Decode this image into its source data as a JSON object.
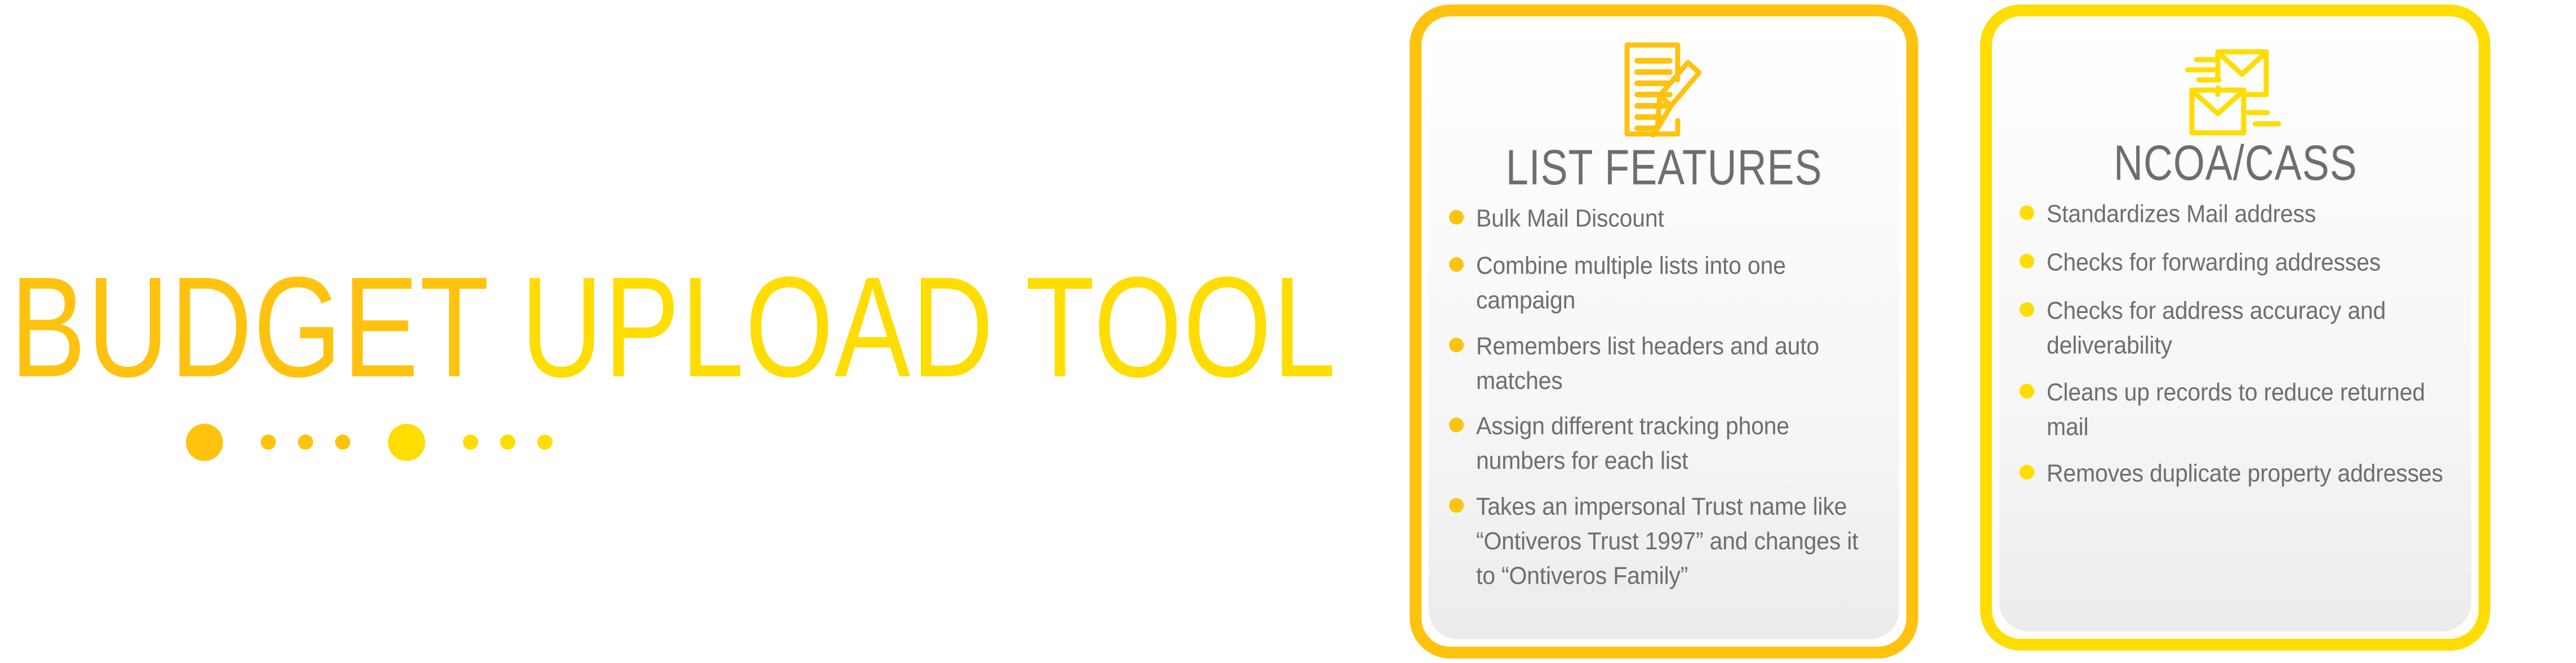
{
  "hero": {
    "title_part1": "BUDGET ",
    "title_part2": "UPLOAD TOOL",
    "accent_amber": "#FFC20E",
    "accent_yellow": "#FFDD00",
    "dots": [
      {
        "size": "big",
        "color": "#FFC20E"
      },
      {
        "size": "small",
        "color": "#FFC20E"
      },
      {
        "size": "small",
        "color": "#FFC20E"
      },
      {
        "size": "small",
        "color": "#FFC20E"
      },
      {
        "size": "big",
        "color": "#FFDD00"
      },
      {
        "size": "small",
        "color": "#FFDD00"
      },
      {
        "size": "small",
        "color": "#FFDD00"
      },
      {
        "size": "small",
        "color": "#FFDD00"
      }
    ]
  },
  "cards": [
    {
      "id": "list-features",
      "icon": "document-pen-icon",
      "title": "LIST FEATURES",
      "border_color": "#FFC20E",
      "bullets": [
        "Bulk Mail Discount",
        "Combine multiple lists into one campaign",
        "Remembers list headers and auto matches",
        "Assign different tracking phone numbers for each list",
        "Takes an impersonal Trust name like “Ontiveros Trust 1997” and changes it to “Ontiveros Family”"
      ]
    },
    {
      "id": "ncoa-cass",
      "icon": "envelopes-forwarding-icon",
      "title": "NCOA/CASS",
      "border_color": "#FFDD00",
      "bullets": [
        "Standardizes Mail address",
        "Checks for forwarding addresses",
        "Checks for address accuracy and deliverability",
        "Cleans up records to reduce returned mail",
        "Removes duplicate property addresses"
      ]
    }
  ]
}
